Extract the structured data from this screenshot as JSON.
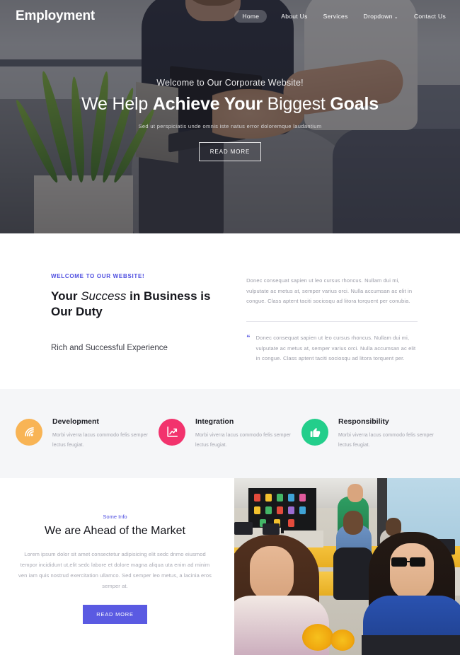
{
  "header": {
    "logo": "Employment",
    "nav": [
      {
        "label": "Home",
        "active": true,
        "icon": ""
      },
      {
        "label": "About Us",
        "active": false,
        "icon": ""
      },
      {
        "label": "Services",
        "active": false,
        "icon": ""
      },
      {
        "label": "Dropdown",
        "active": false,
        "icon": "chevron-down-icon",
        "caret": "⌄"
      },
      {
        "label": "Contact Us",
        "active": false,
        "icon": ""
      }
    ]
  },
  "hero": {
    "welcome": "Welcome to Our Corporate Website!",
    "title_part1": "We Help ",
    "title_part2": "Achieve Your",
    "title_part3": " Biggest ",
    "title_part4": "Goals",
    "subtitle": "Sed ut perspiciatis unde omnis iste natus error doloremque laudantium",
    "button": "READ MORE"
  },
  "about": {
    "eyebrow": "WELCOME TO OUR WEBSITE!",
    "heading_a": "Your ",
    "heading_b": "Success",
    "heading_c": " in Business is Our Duty",
    "subheading": "Rich and Successful Experience",
    "paragraph": "Donec consequat sapien ut leo cursus rhoncus. Nullam dui mi, vulputate ac metus at, semper varius orci. Nulla accumsan ac elit in congue. Class aptent taciti sociosqu ad litora torquent per conubia.",
    "quote_mark": "“",
    "quote": "Donec consequat sapien ut leo cursus rhoncus. Nullam dui mi, vulputate ac metus at, semper varius orci. Nulla accumsan ac elit in congue. Class aptent taciti sociosqu ad litora torquent per."
  },
  "services": [
    {
      "title": "Development",
      "text": "Morbi viverra lacus commodo felis semper lectus feugiat.",
      "icon": "signal-icon",
      "color": "#f8b455"
    },
    {
      "title": "Integration",
      "text": "Morbi viverra lacus commodo felis semper lectus feugiat.",
      "icon": "chart-line-icon",
      "color": "#f2336d"
    },
    {
      "title": "Responsibility",
      "text": "Morbi viverra lacus commodo felis semper lectus feugiat.",
      "icon": "thumbs-up-icon",
      "color": "#23ce8b"
    }
  ],
  "market": {
    "eyebrow": "Some Info",
    "heading": "We are Ahead of the Market",
    "text": "Lorem ipsum dolor sit amet consectetur adipisicing elit sedc dnmo eiusmod tempor incididunt ut,elit sedc labore et dolore magna aliqua uta enim ad minim ven iam quis nostrud exercitation ullamco. Sed semper leo metus, a lacinia eros semper at.",
    "button": "READ MORE",
    "image_alt": "office-team-photo"
  },
  "theme": {
    "accent": "#4e4ee0",
    "button": "#5a5ae2",
    "services_bg": "#f5f6f8"
  }
}
